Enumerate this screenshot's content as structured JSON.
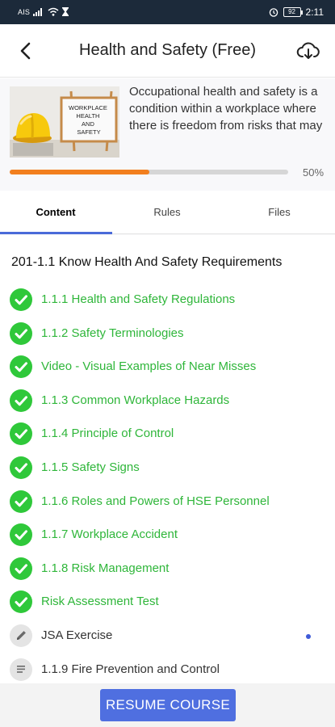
{
  "status_bar": {
    "carrier": "AIS",
    "battery": "92",
    "time": "2:11",
    "icons": [
      "signal-icon",
      "wifi-icon",
      "hourglass-icon",
      "alarm-icon",
      "battery-icon"
    ]
  },
  "header": {
    "title": "Health and Safety (Free)",
    "back_icon": "chevron-left-icon",
    "download_icon": "cloud-download-icon"
  },
  "course": {
    "image_sign_text": "WORKPLACE HEALTH AND SAFETY",
    "description": "Occupational health and safety is a condition within a workplace where there is freedom from risks that may",
    "progress_value": 0.5,
    "progress_label": "50%"
  },
  "tabs": [
    {
      "label": "Content",
      "active": true
    },
    {
      "label": "Rules",
      "active": false
    },
    {
      "label": "Files",
      "active": false
    }
  ],
  "section": {
    "title": "201-1.1 Know Health And Safety Requirements"
  },
  "lessons": [
    {
      "label": "1.1.1 Health and Safety Regulations",
      "status": "done",
      "icon": "check-circle-icon"
    },
    {
      "label": "1.1.2 Safety Terminologies",
      "status": "done",
      "icon": "check-circle-icon"
    },
    {
      "label": "Video - Visual Examples of Near Misses",
      "status": "done",
      "icon": "check-circle-icon"
    },
    {
      "label": "1.1.3 Common Workplace Hazards",
      "status": "done",
      "icon": "check-circle-icon"
    },
    {
      "label": "1.1.4 Principle of Control",
      "status": "done",
      "icon": "check-circle-icon"
    },
    {
      "label": "1.1.5 Safety Signs",
      "status": "done",
      "icon": "check-circle-icon"
    },
    {
      "label": "1.1.6 Roles and Powers of HSE Personnel",
      "status": "done",
      "icon": "check-circle-icon"
    },
    {
      "label": "1.1.7 Workplace Accident",
      "status": "done",
      "icon": "check-circle-icon"
    },
    {
      "label": "1.1.8 Risk Management",
      "status": "done",
      "icon": "check-circle-icon"
    },
    {
      "label": "Risk Assessment Test",
      "status": "done",
      "icon": "check-circle-icon"
    },
    {
      "label": "JSA Exercise",
      "status": "todo",
      "icon": "pencil-icon",
      "new": true
    },
    {
      "label": "1.1.9 Fire Prevention and Control",
      "status": "todo",
      "icon": "document-icon"
    }
  ],
  "footer": {
    "resume_label": "RESUME COURSE"
  },
  "colors": {
    "status_bar": "#1c2a3a",
    "progress": "#f27f1e",
    "done": "#2fc83a",
    "accent": "#4f6fe0"
  }
}
